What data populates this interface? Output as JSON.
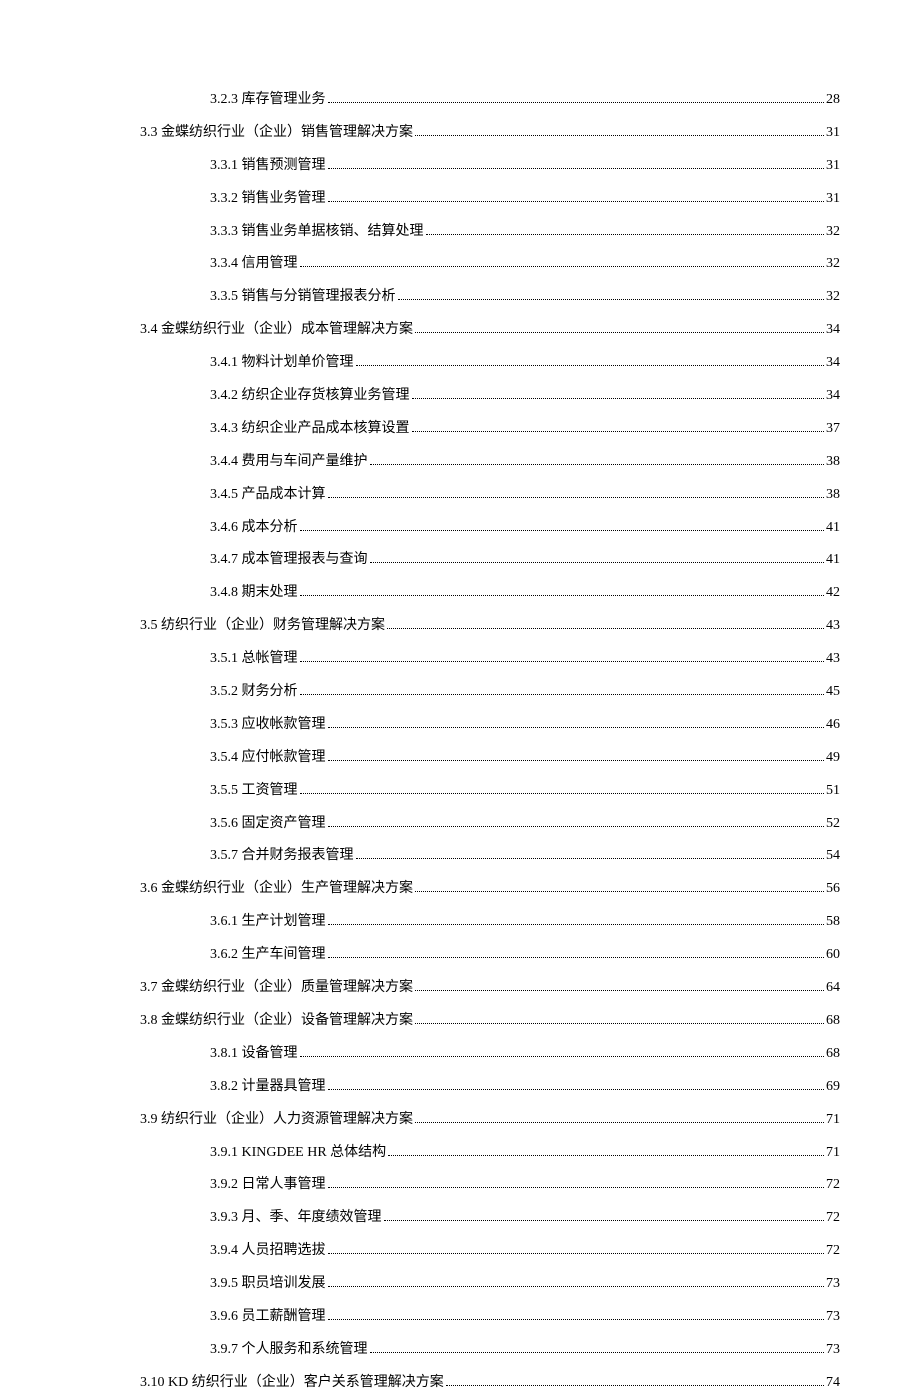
{
  "toc": [
    {
      "level": 3,
      "text": "3.2.3 库存管理业务",
      "page": "28"
    },
    {
      "level": 2,
      "text": "3.3  金蝶纺织行业（企业）销售管理解决方案",
      "page": "31"
    },
    {
      "level": 3,
      "text": "3.3.1 销售预测管理",
      "page": "31"
    },
    {
      "level": 3,
      "text": "3.3.2 销售业务管理",
      "page": "31"
    },
    {
      "level": 3,
      "text": "3.3.3 销售业务单据核销、结算处理",
      "page": "32"
    },
    {
      "level": 3,
      "text": "3.3.4 信用管理",
      "page": "32"
    },
    {
      "level": 3,
      "text": "3.3.5 销售与分销管理报表分析",
      "page": "32"
    },
    {
      "level": 2,
      "text": "3.4  金蝶纺织行业（企业）成本管理解决方案",
      "page": "34"
    },
    {
      "level": 3,
      "text": "3.4.1 物料计划单价管理",
      "page": "34"
    },
    {
      "level": 3,
      "text": "3.4.2  纺织企业存货核算业务管理",
      "page": "34"
    },
    {
      "level": 3,
      "text": "3.4.3 纺织企业产品成本核算设置",
      "page": "37"
    },
    {
      "level": 3,
      "text": "3.4.4  费用与车间产量维护",
      "page": "38"
    },
    {
      "level": 3,
      "text": "3.4.5  产品成本计算",
      "page": "38"
    },
    {
      "level": 3,
      "text": "3.4.6 成本分析",
      "page": "41"
    },
    {
      "level": 3,
      "text": "3.4.7 成本管理报表与查询",
      "page": "41"
    },
    {
      "level": 3,
      "text": "3.4.8 期末处理",
      "page": "42"
    },
    {
      "level": 2,
      "text": "3.5  纺织行业（企业）财务管理解决方案",
      "page": "43"
    },
    {
      "level": 3,
      "text": "3.5.1  总帐管理",
      "page": "43"
    },
    {
      "level": 3,
      "text": "3.5.2  财务分析",
      "page": "45"
    },
    {
      "level": 3,
      "text": "3.5.3  应收帐款管理",
      "page": "46"
    },
    {
      "level": 3,
      "text": "3.5.4  应付帐款管理",
      "page": "49"
    },
    {
      "level": 3,
      "text": "3.5.5 工资管理",
      "page": "51"
    },
    {
      "level": 3,
      "text": "3.5.6 固定资产管理",
      "page": "52"
    },
    {
      "level": 3,
      "text": "3.5.7 合并财务报表管理",
      "page": "54"
    },
    {
      "level": 2,
      "text": "3.6  金蝶纺织行业（企业）生产管理解决方案",
      "page": "56"
    },
    {
      "level": 3,
      "text": "3.6.1  生产计划管理",
      "page": "58"
    },
    {
      "level": 3,
      "text": "3.6.2 生产车间管理",
      "page": "60"
    },
    {
      "level": 2,
      "text": "3.7  金蝶纺织行业（企业）质量管理解决方案",
      "page": "64"
    },
    {
      "level": 2,
      "text": "3.8 金蝶纺织行业（企业）设备管理解决方案",
      "page": "68"
    },
    {
      "level": 3,
      "text": "3.8.1 设备管理",
      "page": "68"
    },
    {
      "level": 3,
      "text": "3.8.2  计量器具管理",
      "page": "69"
    },
    {
      "level": 2,
      "text": "3.9  纺织行业（企业）人力资源管理解决方案",
      "page": "71"
    },
    {
      "level": 3,
      "text": "3.9.1 KINGDEE HR 总体结构",
      "page": "71"
    },
    {
      "level": 3,
      "text": "3.9.2 日常人事管理",
      "page": "72"
    },
    {
      "level": 3,
      "text": "3.9.3 月、季、年度绩效管理",
      "page": "72"
    },
    {
      "level": 3,
      "text": "3.9.4 人员招聘选拔",
      "page": "72"
    },
    {
      "level": 3,
      "text": "3.9.5 职员培训发展",
      "page": "73"
    },
    {
      "level": 3,
      "text": "3.9.6 员工薪酬管理",
      "page": "73"
    },
    {
      "level": 3,
      "text": "3.9.7 个人服务和系统管理",
      "page": "73"
    },
    {
      "level": 2,
      "text": "3.10 KD 纺织行业（企业）客户关系管理解决方案",
      "page": "74"
    }
  ]
}
